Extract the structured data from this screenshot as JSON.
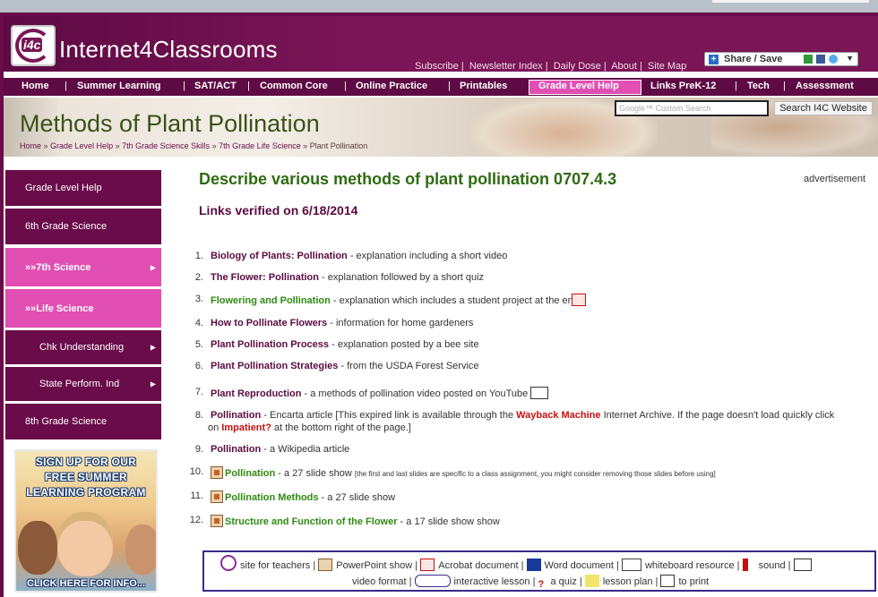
{
  "site": {
    "name": "Internet4Classrooms",
    "logo_text": "i4c"
  },
  "toplinks": [
    "Subscribe",
    "Newsletter Index",
    "Daily Dose",
    "About",
    "Site Map"
  ],
  "share": {
    "label": "Share / Save"
  },
  "nav": [
    "Home",
    "Summer Learning",
    "SAT/ACT",
    "Common Core",
    "Online Practice",
    "Printables",
    "Grade Level Help",
    "Links PreK-12",
    "Tech",
    "Assessment"
  ],
  "banner": {
    "title": "Methods of Plant Pollination",
    "breadcrumbs": [
      "Home",
      "Grade Level Help",
      "7th Grade Science Skills",
      "7th Grade Life Science",
      "Plant Pollination"
    ],
    "search_placeholder": "Google™ Custom Search",
    "search_button": "Search I4C Website"
  },
  "sidebar": {
    "items": [
      {
        "label": "Grade Level Help",
        "style": "dark"
      },
      {
        "label": "6th Grade Science",
        "style": "dark"
      },
      {
        "label": "7th Science",
        "style": "pink"
      },
      {
        "label": "Life Science",
        "style": "pink"
      },
      {
        "label": "Chk Understanding",
        "style": "dark"
      },
      {
        "label": "State Perform. Ind",
        "style": "dark"
      },
      {
        "label": "8th Grade Science",
        "style": "dark"
      }
    ],
    "promo": {
      "headline": [
        "SIGN UP FOR OUR",
        "FREE SUMMER",
        "LEARNING PROGRAM"
      ],
      "footer": "CLICK HERE FOR INFO..."
    }
  },
  "main": {
    "heading": "Describe various methods of plant pollination 0707.4.3",
    "verified": "Links verified on 6/18/2014",
    "advertisement": "advertisement",
    "items": [
      {
        "num": "1.",
        "link": "Biology of Plants: Pollination",
        "desc": " - explanation including a short video"
      },
      {
        "num": "2.",
        "link": "The Flower: Pollination",
        "desc": " - explanation followed by a short quiz"
      },
      {
        "num": "3.",
        "link": "Flowering and Pollination",
        "desc": "  - explanation which includes a student project at the end"
      },
      {
        "num": "4.",
        "link": "How to Pollinate Flowers",
        "desc": " - information for home gardeners"
      },
      {
        "num": "5.",
        "link": "Plant Pollination Process",
        "desc": " - explanation posted by a bee site"
      },
      {
        "num": "6.",
        "link": "Plant Pollination Strategies",
        "desc": " - from the USDA Forest Service"
      },
      {
        "num": "7.",
        "link": "Plant Reproduction",
        "desc": " - a methods of pollination video posted on YouTube"
      },
      {
        "num": "8.",
        "link": "Pollination",
        "desc": " - Encarta article [This expired link is available through the ",
        "link2": "Wayback Machine",
        "desc2": " Internet Archive. If the page doesn't load quickly click",
        "line2a": "on ",
        "link3": "Impatient?",
        "line2b": " at the bottom right of the page.]"
      },
      {
        "num": "9.",
        "link": "Pollination",
        "desc": " - a Wikipedia article"
      },
      {
        "num": "10.",
        "link": "Pollination",
        "desc": " - a 27 slide show ",
        "note": "[the first and last slides are specific to a class assignment, you might consider removing those slides before using]"
      },
      {
        "num": "11.",
        "link": "Pollination Methods",
        "desc": " - a 27 slide show"
      },
      {
        "num": "12.",
        "link": "Structure and Function of the Flower",
        "desc": "   - a 17 slide show show"
      }
    ]
  },
  "legend": {
    "row1": [
      "site for teachers",
      "PowerPoint show",
      "Acrobat document",
      "Word document",
      "whiteboard resource",
      "sound"
    ],
    "row2": [
      "video format",
      "interactive lesson",
      "a quiz",
      "lesson plan",
      "to print"
    ]
  }
}
